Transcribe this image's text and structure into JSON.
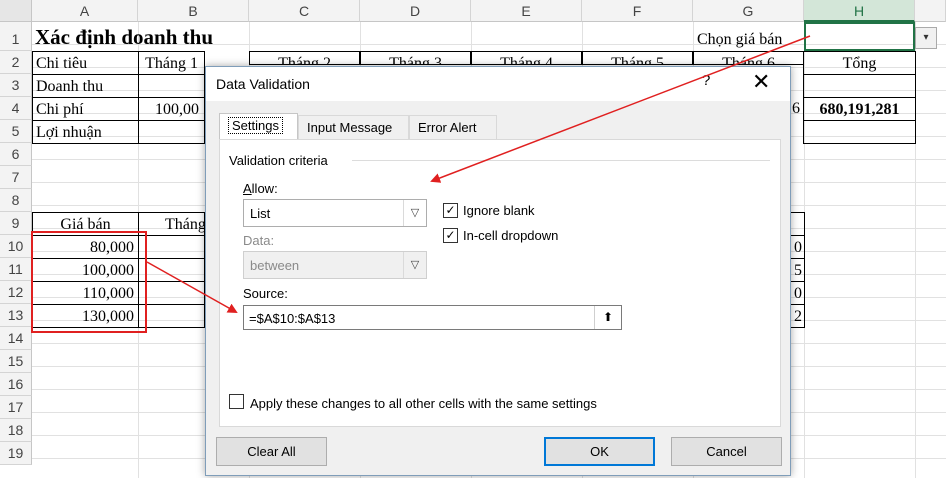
{
  "columns": [
    "A",
    "B",
    "C",
    "D",
    "E",
    "F",
    "G",
    "H"
  ],
  "rows": [
    "1",
    "2",
    "3",
    "4",
    "5",
    "6",
    "7",
    "8",
    "9",
    "10",
    "11",
    "12",
    "13",
    "14",
    "15",
    "16",
    "17",
    "18",
    "19"
  ],
  "sheet": {
    "title": "Xác định doanh thu",
    "chon_gia_ban": "Chọn giá bán",
    "row2": {
      "a": "Chi tiêu",
      "b": "Tháng 1",
      "c": "Tháng 2",
      "d": "Tháng 3",
      "e": "Tháng 4",
      "f": "Tháng 5",
      "g": "Tháng 6",
      "h": "Tổng"
    },
    "row3_a": "Doanh thu",
    "row4": {
      "a": "Chi phí",
      "b": "100,00",
      "g": "6",
      "h": "680,191,281"
    },
    "row5_a": "Lợi nhuận",
    "row9": {
      "a": "Giá bán",
      "b": "Tháng"
    },
    "prices": [
      "80,000",
      "100,000",
      "110,000",
      "130,000"
    ],
    "right_digits": [
      "0",
      "5",
      "0",
      "2"
    ]
  },
  "dialog": {
    "title": "Data Validation",
    "help": "?",
    "close": "✕",
    "tabs": [
      "Settings",
      "Input Message",
      "Error Alert"
    ],
    "group": "Validation criteria",
    "allow_label": "Allow:",
    "allow_value": "List",
    "ignore_blank": "Ignore blank",
    "in_cell_dropdown": "In-cell dropdown",
    "data_label": "Data:",
    "data_value": "between",
    "source_label": "Source:",
    "source_value": "=$A$10:$A$13",
    "apply_all": "Apply these changes to all other cells with the same settings",
    "clear_all": "Clear All",
    "ok": "OK",
    "cancel": "Cancel"
  },
  "colors": {
    "accent": "#217346",
    "annotation": "#e02020",
    "dialog_default": "#0078d7"
  }
}
